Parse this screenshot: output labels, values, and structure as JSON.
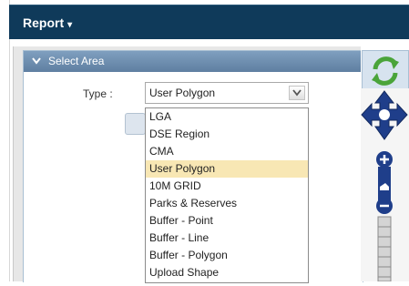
{
  "header": {
    "report_label": "Report",
    "caret": "▾"
  },
  "panel": {
    "title": "Select Area",
    "chevron": "❯"
  },
  "type_field": {
    "label": "Type :",
    "value": "User Polygon",
    "options": [
      "LGA",
      "DSE Region",
      "CMA",
      "User Polygon",
      "10M GRID",
      "Parks & Reserves",
      "Buffer - Point",
      "Buffer - Line",
      "Buffer - Polygon",
      "Upload Shape"
    ],
    "selected": "User Polygon"
  },
  "colors": {
    "header_bg": "#0f3a5a",
    "panel_head": "#6f8fb1",
    "selected_bg": "#f8e7b4",
    "nav_blue": "#1f3e8a"
  },
  "icons": {
    "refresh": "refresh-icon",
    "pan": "pan-arrows-icon",
    "zoom_in": "zoom-in-icon",
    "zoom_out": "zoom-out-icon",
    "dropdown": "dropdown-arrow-icon"
  }
}
